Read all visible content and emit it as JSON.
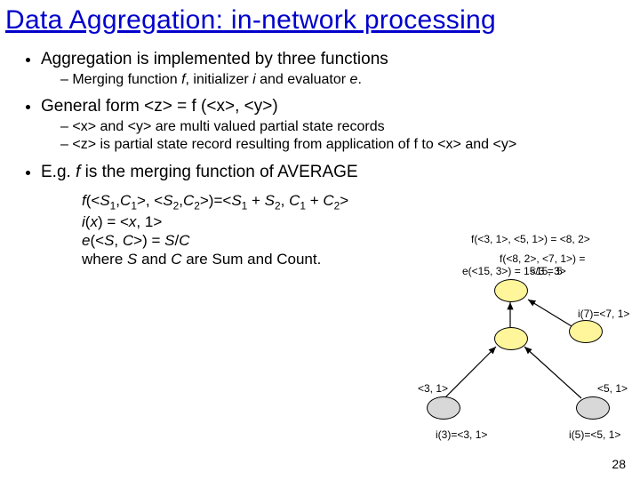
{
  "title": "Data Aggregation: in-network processing",
  "b1": {
    "text": "Aggregation is implemented by three functions",
    "sub1": "Merging function f, initializer i and evaluator e."
  },
  "b2": {
    "text": "General form   <z> = f (<x>, <y>)",
    "sub1": "<x> and <y> are multi valued partial state records",
    "sub2": "<z> is partial state record resulting from application of f to <x> and <y>"
  },
  "b3": {
    "text": "E.g. f is the merging function of AVERAGE"
  },
  "formula": {
    "l1a": "f(<S",
    "l1b": ",C",
    "l1c": ">, <S",
    "l1d": ",C",
    "l1e": ">)=<S",
    "l1f": " + S",
    "l1g": ", C",
    "l1h": " + C",
    "l1i": ">",
    "l2": "i(x) = <x, 1>",
    "l3": "e(<S, C>) = S/C",
    "l4": "where S and C are Sum and Count."
  },
  "diagram": {
    "top": "f(<3, 1>, <5, 1>) = <8, 2>",
    "mid1": "f(<8, 2>, <7, 1>) =",
    "mid2": "e(<15, 3>) = 15/3 = 5",
    "mid3": "<15, 3>",
    "i7": "i(7)=<7, 1>",
    "i3": "i(3)=<3, 1>",
    "i5": "i(5)=<5, 1>",
    "l31": "<3, 1>",
    "l51": "<5, 1>"
  },
  "page": "28"
}
